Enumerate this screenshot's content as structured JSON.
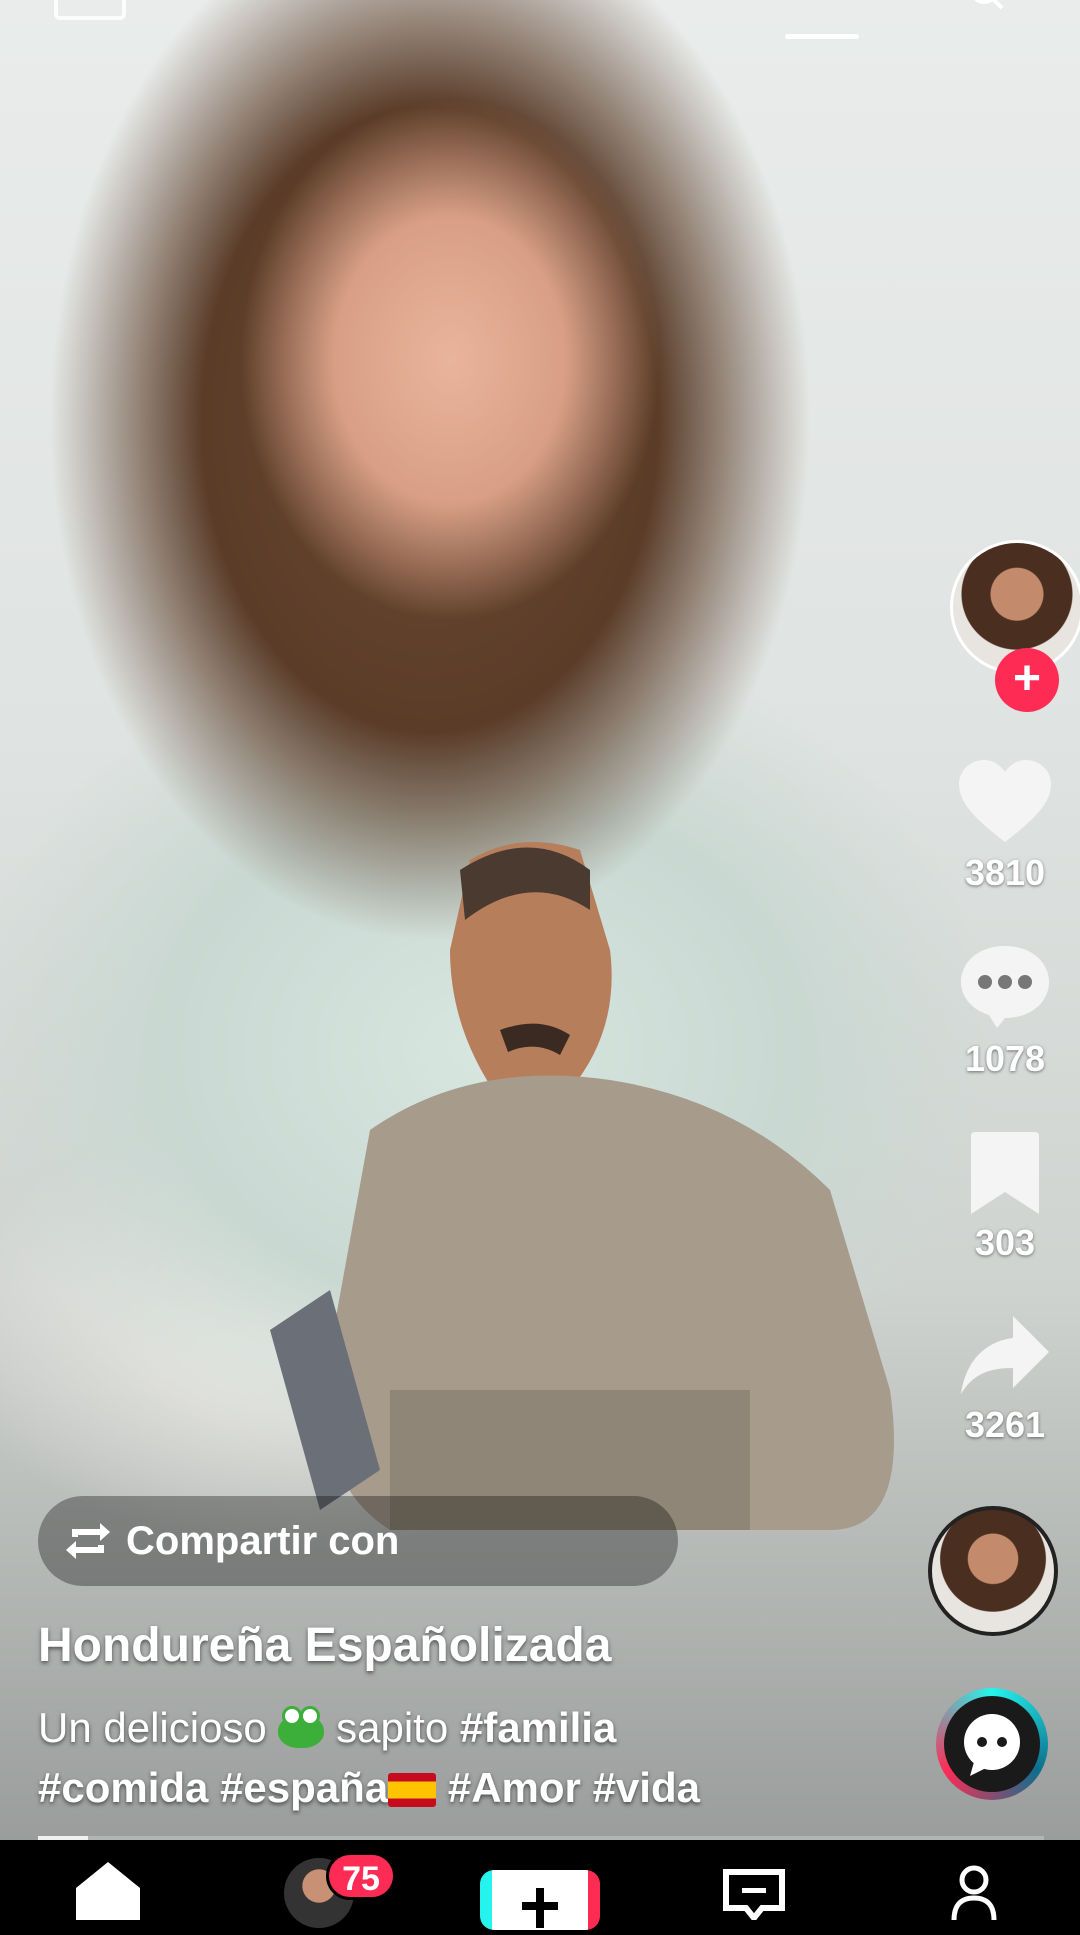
{
  "creator": {
    "username": "Hondureña Españolizada",
    "caption_parts": [
      {
        "text": "Un delicioso ",
        "tag": false
      },
      {
        "icon": "frog-emoji"
      },
      {
        "text": " sapito ",
        "tag": false
      },
      {
        "text": "#familia",
        "tag": true
      },
      {
        "break": true
      },
      {
        "text": "#comida",
        "tag": true
      },
      {
        "text": " ",
        "tag": false
      },
      {
        "text": "#españa",
        "tag": true
      },
      {
        "icon": "spain-flag-emoji"
      },
      {
        "text": " ",
        "tag": false
      },
      {
        "text": "#Amor",
        "tag": true
      },
      {
        "text": " ",
        "tag": false
      },
      {
        "text": "#vida",
        "tag": true
      }
    ]
  },
  "share_banner": {
    "label": "Compartir con"
  },
  "actions": {
    "likes": "3810",
    "comments": "1078",
    "saves": "303",
    "shares": "3261"
  },
  "nav": {
    "inbox_badge": "75"
  },
  "progress": {
    "fraction": 0.05
  },
  "colors": {
    "accent": "#fe2c55",
    "teal": "#25f4ee"
  }
}
